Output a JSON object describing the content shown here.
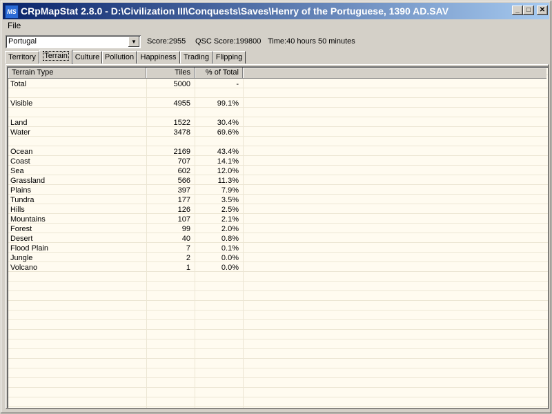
{
  "window": {
    "title": "CRpMapStat 2.8.0 - D:\\Civilization III\\Conquests\\Saves\\Henry of the Portuguese, 1390 AD.SAV",
    "minimize": "_",
    "maximize": "□",
    "close": "✕"
  },
  "menu": {
    "file": "File"
  },
  "toolbar": {
    "civ_select": "Portugal",
    "score": "Score:2955",
    "qsc_score": "QSC Score:199800",
    "time": "Time:40 hours 50 minutes"
  },
  "tabs": [
    "Territory",
    "Terrain",
    "Culture",
    "Pollution",
    "Happiness",
    "Trading",
    "Flipping"
  ],
  "active_tab": "Terrain",
  "table": {
    "headers": {
      "type": "Terrain Type",
      "tiles": "Tiles",
      "percent": "% of Total"
    },
    "rows": [
      {
        "type": "Total",
        "tiles": "5000",
        "percent": "-"
      },
      {
        "type": "",
        "tiles": "",
        "percent": ""
      },
      {
        "type": "Visible",
        "tiles": "4955",
        "percent": "99.1%"
      },
      {
        "type": "",
        "tiles": "",
        "percent": ""
      },
      {
        "type": "Land",
        "tiles": "1522",
        "percent": "30.4%"
      },
      {
        "type": "Water",
        "tiles": "3478",
        "percent": "69.6%"
      },
      {
        "type": "",
        "tiles": "",
        "percent": ""
      },
      {
        "type": "Ocean",
        "tiles": "2169",
        "percent": "43.4%"
      },
      {
        "type": "Coast",
        "tiles": "707",
        "percent": "14.1%"
      },
      {
        "type": "Sea",
        "tiles": "602",
        "percent": "12.0%"
      },
      {
        "type": "Grassland",
        "tiles": "566",
        "percent": "11.3%"
      },
      {
        "type": "Plains",
        "tiles": "397",
        "percent": "7.9%"
      },
      {
        "type": "Tundra",
        "tiles": "177",
        "percent": "3.5%"
      },
      {
        "type": "Hills",
        "tiles": "126",
        "percent": "2.5%"
      },
      {
        "type": "Mountains",
        "tiles": "107",
        "percent": "2.1%"
      },
      {
        "type": "Forest",
        "tiles": "99",
        "percent": "2.0%"
      },
      {
        "type": "Desert",
        "tiles": "40",
        "percent": "0.8%"
      },
      {
        "type": "Flood Plain",
        "tiles": "7",
        "percent": "0.1%"
      },
      {
        "type": "Jungle",
        "tiles": "2",
        "percent": "0.0%"
      },
      {
        "type": "Volcano",
        "tiles": "1",
        "percent": "0.0%"
      }
    ]
  }
}
